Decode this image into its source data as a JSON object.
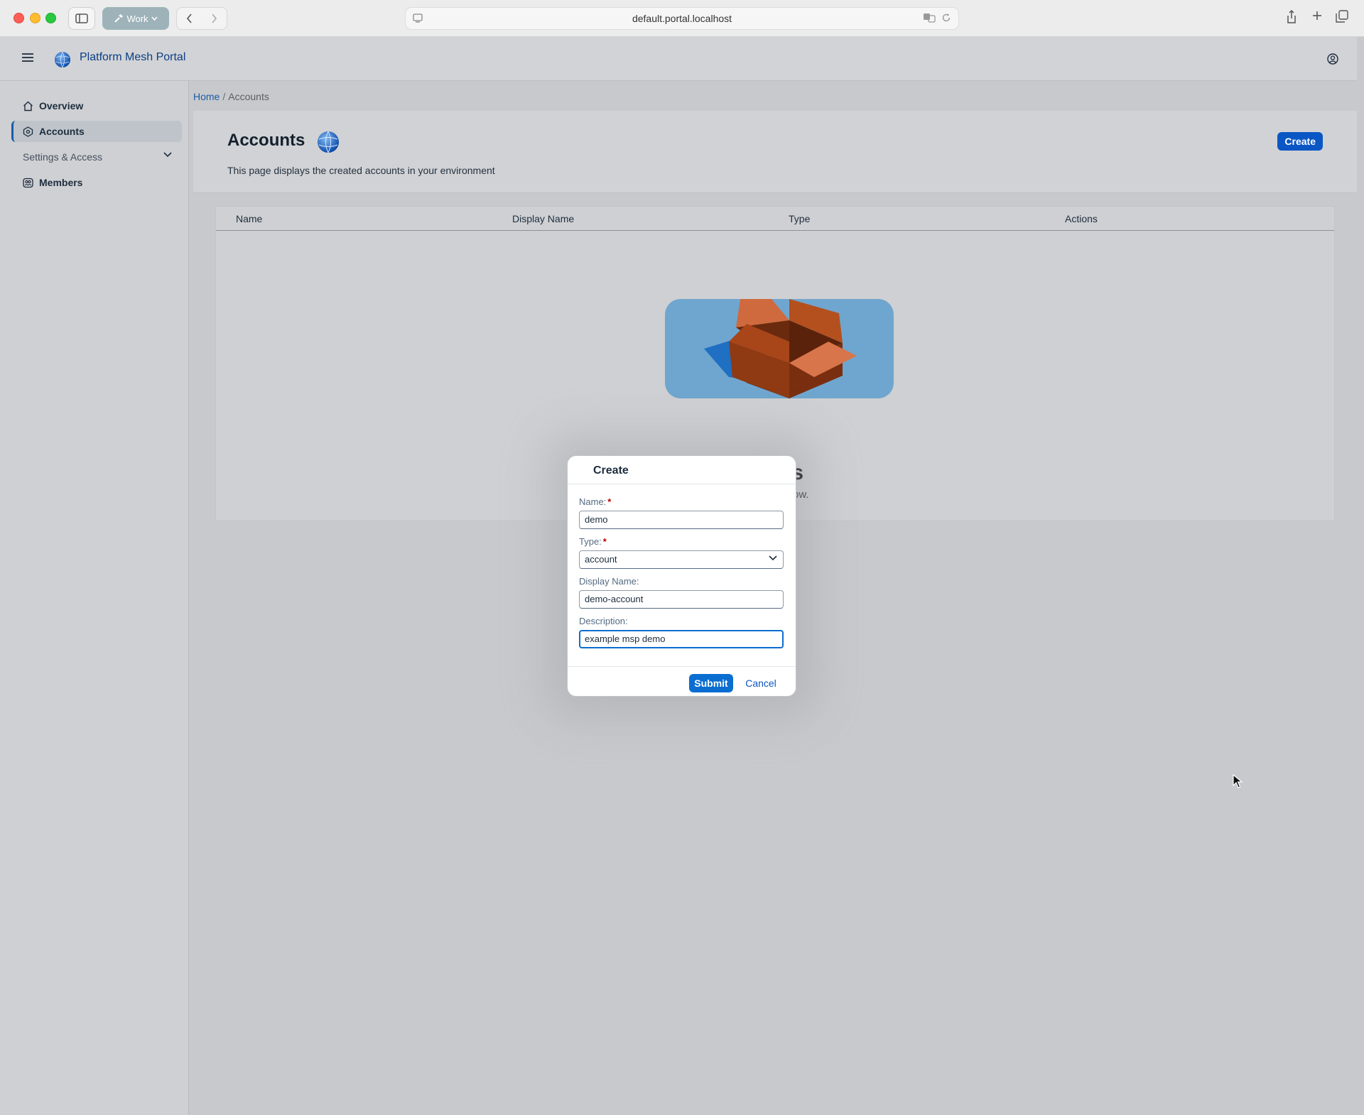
{
  "browser": {
    "profile_label": "Work",
    "url": "default.portal.localhost"
  },
  "app": {
    "title": "Platform Mesh Portal"
  },
  "sidebar": {
    "items": [
      {
        "label": "Overview",
        "icon": "home-icon"
      },
      {
        "label": "Accounts",
        "icon": "accounts-icon",
        "active": true
      },
      {
        "label": "Settings & Access",
        "icon": "chevron-down-icon"
      },
      {
        "label": "Members",
        "icon": "members-icon"
      }
    ]
  },
  "breadcrumb": {
    "home": "Home",
    "separator": "/",
    "current": "Accounts"
  },
  "page": {
    "title": "Accounts",
    "description": "This page displays the created accounts in your environment",
    "create_label": "Create"
  },
  "table": {
    "columns": [
      "Name",
      "Display Name",
      "Type",
      "Actions"
    ],
    "empty_title": "urces",
    "empty_subtitle": "items to show."
  },
  "dialog": {
    "title": "Create",
    "name_label": "Name:",
    "name_value": "demo",
    "type_label": "Type:",
    "type_value": "account",
    "display_name_label": "Display Name:",
    "display_name_value": "demo-account",
    "description_label": "Description:",
    "description_value": "example msp demo",
    "required_marker": "*",
    "submit_label": "Submit",
    "cancel_label": "Cancel"
  },
  "colors": {
    "accent": "#0a6ed1",
    "brand_text": "#0a3f85",
    "required": "#bb0000"
  }
}
